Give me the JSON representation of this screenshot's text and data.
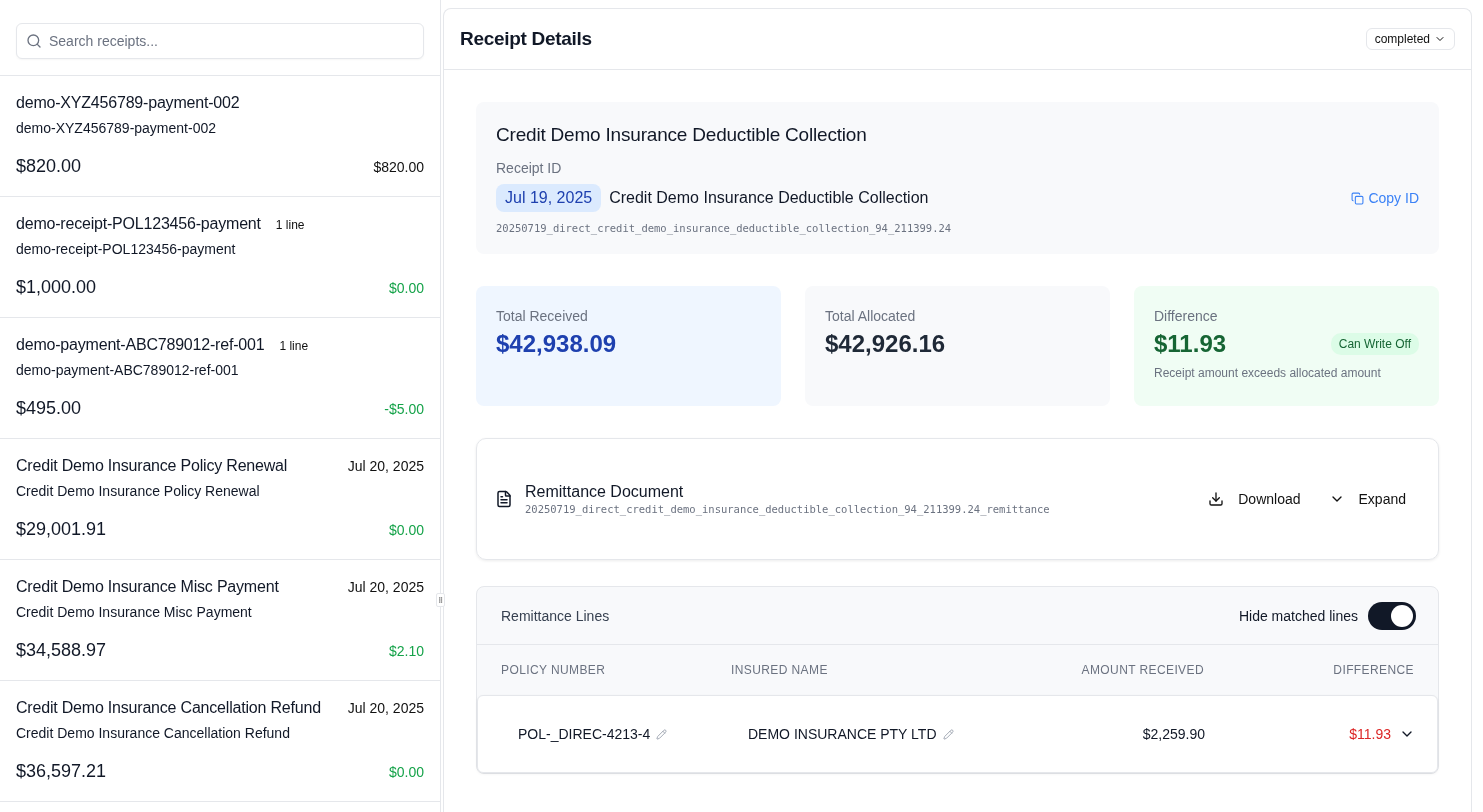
{
  "search": {
    "placeholder": "Search receipts..."
  },
  "receipts": [
    {
      "title": "demo-XYZ456789-payment-002",
      "subtitle": "demo-XYZ456789-payment-002",
      "amount": "$820.00",
      "difference": "$820.00",
      "color": "#111111"
    },
    {
      "title": "demo-receipt-POL123456-payment",
      "badge": "1 line",
      "subtitle": "demo-receipt-POL123456-payment",
      "amount": "$1,000.00",
      "difference": "$0.00",
      "color": "#16a34a"
    },
    {
      "title": "demo-payment-ABC789012-ref-001",
      "badge": "1 line",
      "subtitle": "demo-payment-ABC789012-ref-001",
      "amount": "$495.00",
      "difference": "-$5.00",
      "color": "#16a34a"
    },
    {
      "title": "Credit Demo Insurance Policy Renewal",
      "date": "Jul 20, 2025",
      "subtitle": "Credit Demo Insurance Policy Renewal",
      "amount": "$29,001.91",
      "difference": "$0.00",
      "color": "#16a34a"
    },
    {
      "title": "Credit Demo Insurance Misc Payment",
      "date": "Jul 20, 2025",
      "subtitle": "Credit Demo Insurance Misc Payment",
      "amount": "$34,588.97",
      "difference": "$2.10",
      "color": "#16a34a"
    },
    {
      "title": "Credit Demo Insurance Cancellation Refund",
      "date": "Jul 20, 2025",
      "subtitle": "Credit Demo Insurance Cancellation Refund",
      "amount": "$36,597.21",
      "difference": "$0.00",
      "color": "#16a34a"
    }
  ],
  "details": {
    "title": "Receipt Details",
    "status": "completed",
    "receipt": {
      "name": "Credit Demo Insurance Deductible Collection",
      "id_label": "Receipt ID",
      "date": "Jul 19, 2025",
      "description": "Credit Demo Insurance Deductible Collection",
      "copy": "Copy ID",
      "reference": "20250719_direct_credit_demo_insurance_deductible_collection_94_211399.24"
    },
    "stats": [
      {
        "kind": "received",
        "label": "Total Received",
        "value": "$42,938.09"
      },
      {
        "kind": "allocated",
        "label": "Total Allocated",
        "value": "$42,926.16"
      },
      {
        "kind": "difference",
        "label": "Difference",
        "value": "$11.93",
        "badge": "Can Write Off",
        "note": "Receipt amount exceeds allocated amount"
      }
    ],
    "document": {
      "title": "Remittance Document",
      "file": "20250719_direct_credit_demo_insurance_deductible_collection_94_211399.24_remittance",
      "download": "Download",
      "expand": "Expand"
    },
    "lines": {
      "title": "Remittance Lines",
      "toggle_label": "Hide matched lines",
      "toggle_on": true,
      "columns": [
        "POLICY NUMBER",
        "INSURED NAME",
        "AMOUNT RECEIVED",
        "DIFFERENCE"
      ],
      "rows": [
        {
          "policy": "POL-_DIREC-4213-4",
          "insured": "DEMO INSURANCE PTY LTD",
          "amount": "$2,259.90",
          "difference": "$11.93",
          "color": "#dc2626",
          "expanded": false
        }
      ]
    }
  }
}
